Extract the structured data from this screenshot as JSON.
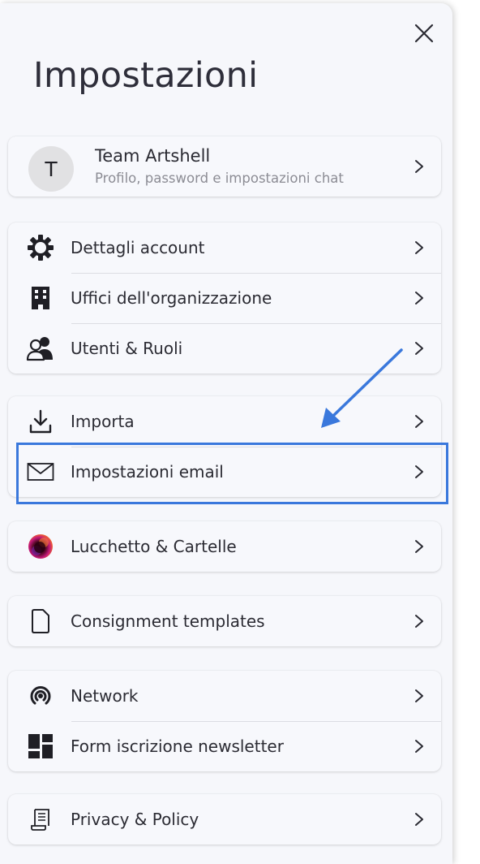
{
  "header": {
    "title": "Impostazioni",
    "close_icon": "close-icon"
  },
  "profile": {
    "avatar_initial": "T",
    "name": "Team Artshell",
    "subtitle": "Profilo, password e impostazioni chat"
  },
  "groups": [
    {
      "items": [
        {
          "label": "Dettagli account",
          "icon": "gear-icon"
        },
        {
          "label": "Uffici dell'organizzazione",
          "icon": "building-icon"
        },
        {
          "label": "Utenti & Ruoli",
          "icon": "users-icon"
        }
      ]
    },
    {
      "items": [
        {
          "label": "Importa",
          "icon": "download-icon"
        },
        {
          "label": "Impostazioni email",
          "icon": "envelope-icon"
        }
      ]
    },
    {
      "items": [
        {
          "label": "Lucchetto & Cartelle",
          "icon": "lucchetto-logo-icon"
        }
      ]
    },
    {
      "items": [
        {
          "label": "Consignment templates",
          "icon": "document-icon"
        }
      ]
    },
    {
      "items": [
        {
          "label": "Network",
          "icon": "broadcast-icon"
        },
        {
          "label": "Form iscrizione newsletter",
          "icon": "dashboard-grid-icon"
        }
      ]
    },
    {
      "items": [
        {
          "label": "Privacy & Policy",
          "icon": "scroll-icon"
        }
      ]
    }
  ],
  "annotation": {
    "highlight_color": "#3a78dc",
    "arrow_color": "#3a78dc",
    "highlighted_item": "Impostazioni email"
  }
}
